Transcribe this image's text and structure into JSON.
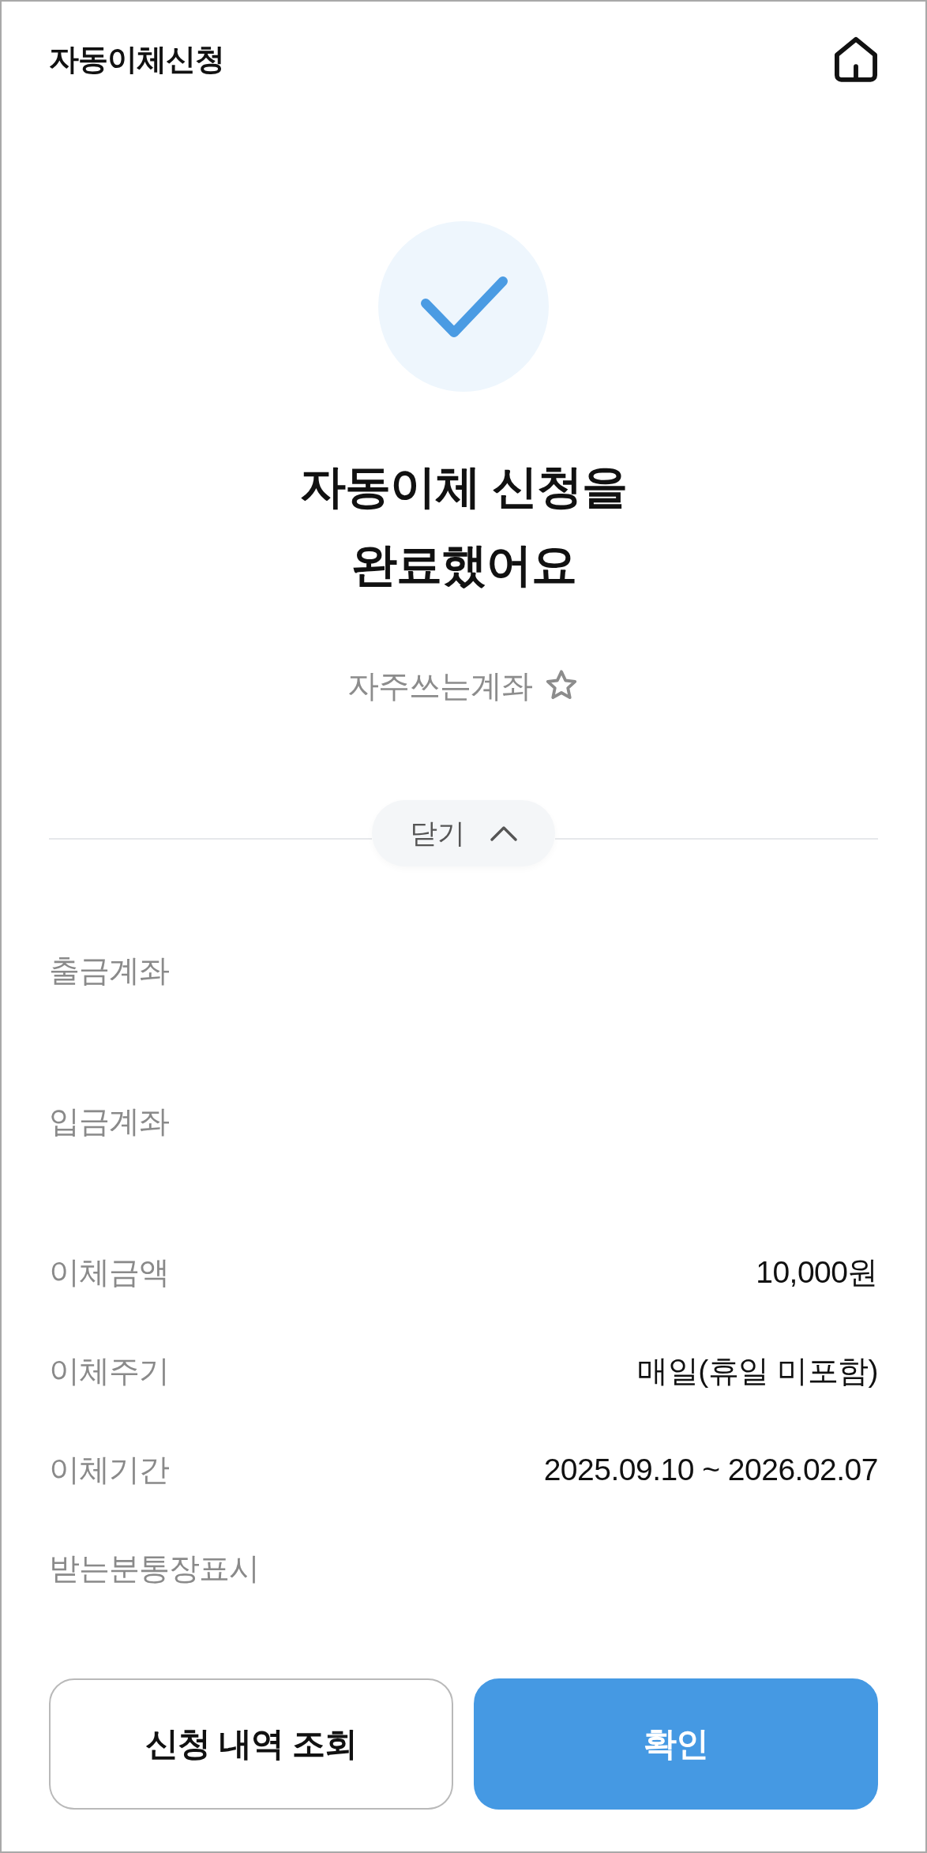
{
  "header": {
    "title": "자동이체신청"
  },
  "result": {
    "headline_lines": [
      "자동이체 신청을",
      "완료했어요"
    ],
    "favorite": {
      "label": "자주쓰는계좌",
      "starred": false
    }
  },
  "collapse_toggle": {
    "label": "닫기",
    "expanded": true
  },
  "details": [
    {
      "kind": "account",
      "label": "출금계좌"
    },
    {
      "kind": "account",
      "label": "입금계좌"
    },
    {
      "kind": "text",
      "label": "이체금액",
      "value": "10,000원"
    },
    {
      "kind": "text",
      "label": "이체주기",
      "value": "매일(휴일 미포함)"
    },
    {
      "kind": "text",
      "label": "이체기간",
      "value": "2025.09.10 ~ 2026.02.07"
    },
    {
      "kind": "text",
      "label": "받는분통장표시"
    }
  ],
  "buttons": [
    {
      "kind": "secondary",
      "label": "신청 내역 조회"
    },
    {
      "kind": "primary",
      "label": "확인"
    }
  ]
}
